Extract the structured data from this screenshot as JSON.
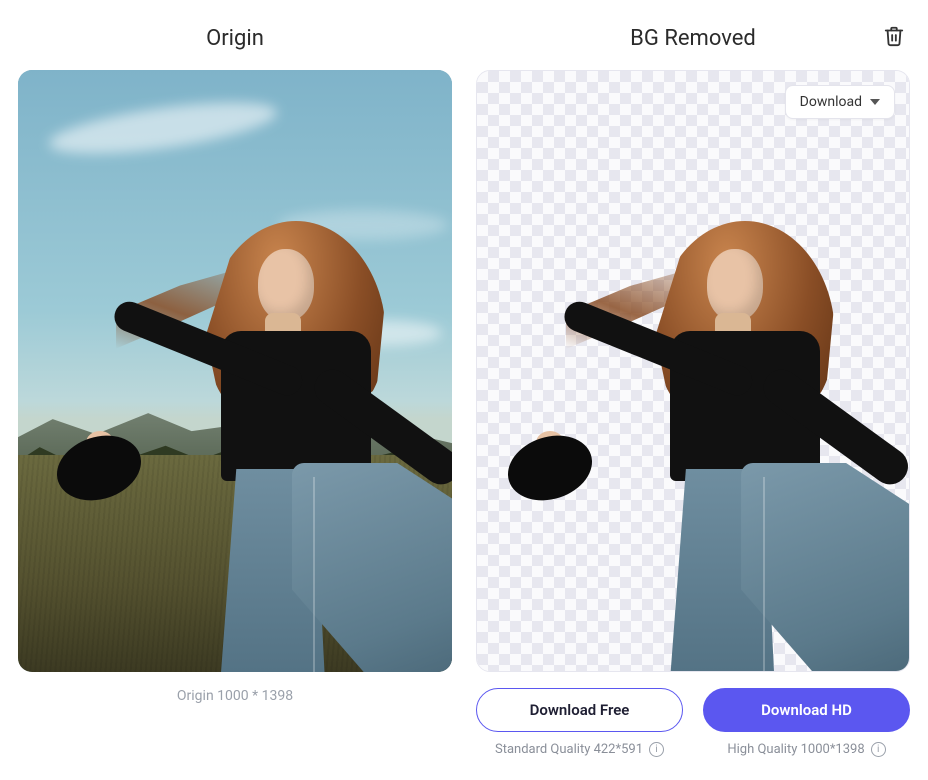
{
  "left": {
    "title": "Origin",
    "caption": "Origin 1000 * 1398"
  },
  "right": {
    "title": "BG Removed",
    "download_dropdown_label": "Download",
    "actions": {
      "free": {
        "label": "Download Free",
        "sub": "Standard Quality 422*591"
      },
      "hd": {
        "label": "Download HD",
        "sub": "High Quality 1000*1398"
      }
    }
  },
  "icons": {
    "trash": "trash-icon",
    "caret": "caret-down-icon",
    "info": "info-icon"
  },
  "colors": {
    "accent": "#5b57f0",
    "muted_text": "#9aa0aa"
  }
}
